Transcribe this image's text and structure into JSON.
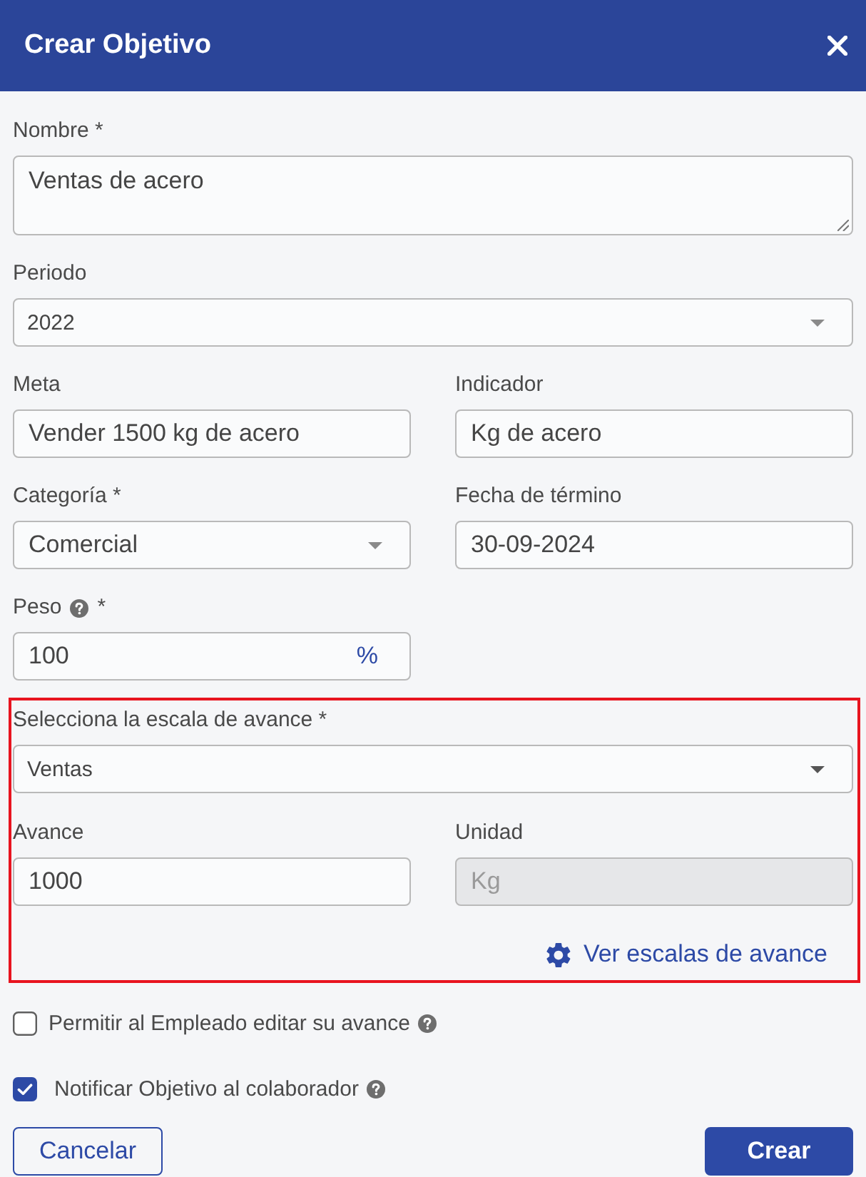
{
  "dialog": {
    "title": "Crear Objetivo"
  },
  "fields": [
    {
      "kind": "textarea",
      "label": "Nombre *",
      "value": "Ventas de acero",
      "help_icon": false,
      "disabled": false
    },
    {
      "kind": "dropdown",
      "label": "Periodo",
      "value": "2022",
      "help_icon": false,
      "disabled": false
    },
    {
      "kind": "input",
      "label": "Meta",
      "value": "Vender 1500 kg de acero",
      "help_icon": false,
      "disabled": false
    },
    {
      "kind": "input",
      "label": "Indicador",
      "value": "Kg de acero",
      "help_icon": false,
      "disabled": false
    },
    {
      "kind": "select",
      "label": "Categoría *",
      "value": "Comercial",
      "help_icon": false,
      "disabled": false
    },
    {
      "kind": "input",
      "label": "Fecha de término",
      "value": "30-09-2024",
      "help_icon": false,
      "disabled": false
    },
    {
      "kind": "input",
      "label": "Peso",
      "label_suffix": "*",
      "value": "100",
      "unit": "%",
      "help_icon": true,
      "disabled": false
    }
  ],
  "section": {
    "highlighted": true,
    "fields": [
      {
        "kind": "dropdown",
        "label": "Selecciona la escala de avance *",
        "value": "Ventas",
        "help_icon": false,
        "disabled": false
      },
      {
        "kind": "input",
        "label": "Avance",
        "value": "1000",
        "help_icon": false,
        "disabled": false
      },
      {
        "kind": "input",
        "label": "Unidad",
        "value": "Kg",
        "help_icon": false,
        "disabled": true
      }
    ],
    "link": {
      "label": "Ver escalas de avance"
    }
  },
  "options": [
    {
      "label": "Permitir al Empleado editar su avance",
      "checked": false,
      "help_icon": true
    },
    {
      "label": "Notificar Objetivo al colaborador",
      "checked": true,
      "help_icon": true
    }
  ],
  "buttons": [
    {
      "label": "Cancelar",
      "kind": "secondary"
    },
    {
      "label": "Crear",
      "kind": "primary"
    }
  ]
}
